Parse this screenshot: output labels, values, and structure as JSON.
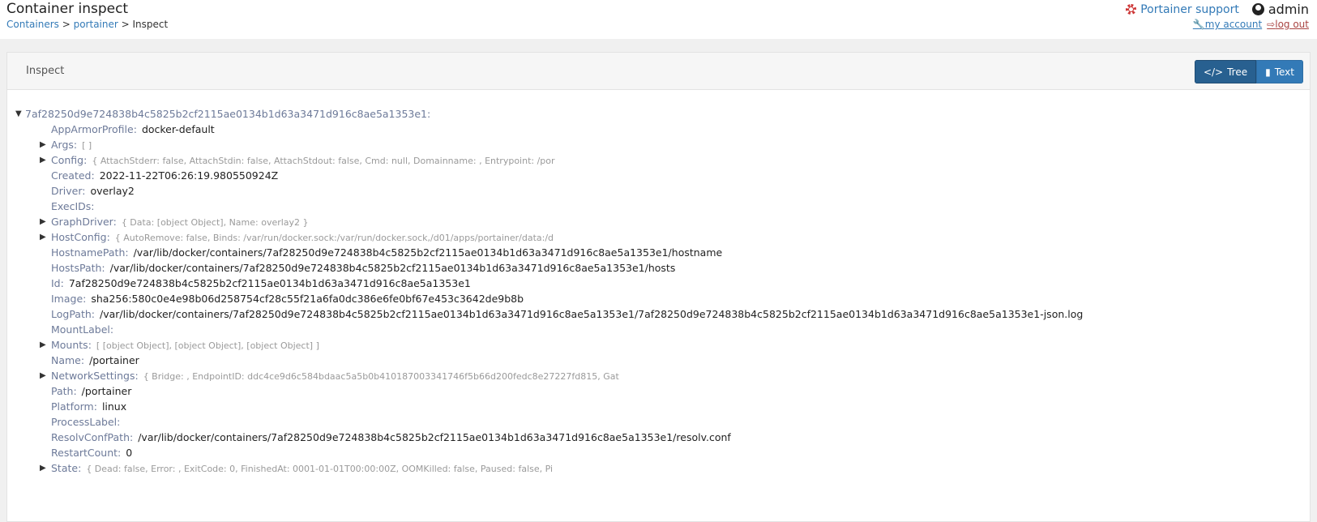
{
  "header": {
    "title": "Container inspect",
    "breadcrumb": [
      "Containers",
      "portainer",
      "Inspect"
    ],
    "support": "Portainer support",
    "user": "admin",
    "my_account": "my account",
    "log_out": "log out"
  },
  "panel": {
    "title": "Inspect",
    "tree_label": "Tree",
    "text_label": "Text"
  },
  "tree": {
    "root": "7af28250d9e724838b4c5825b2cf2115ae0134b1d63a3471d916c8ae5a1353e1:",
    "rows": [
      {
        "key": "AppArmorProfile:",
        "value": "docker-default",
        "expandable": false
      },
      {
        "key": "Args:",
        "preview": "[ ]",
        "expandable": true
      },
      {
        "key": "Config:",
        "preview": "{ AttachStderr: false, AttachStdin: false, AttachStdout: false, Cmd: null, Domainname: , Entrypoint: /por",
        "expandable": true
      },
      {
        "key": "Created:",
        "value": "2022-11-22T06:26:19.980550924Z",
        "expandable": false
      },
      {
        "key": "Driver:",
        "value": "overlay2",
        "expandable": false
      },
      {
        "key": "ExecIDs:",
        "value": "",
        "expandable": false
      },
      {
        "key": "GraphDriver:",
        "preview": "{ Data: [object Object], Name: overlay2 }",
        "expandable": true
      },
      {
        "key": "HostConfig:",
        "preview": "{ AutoRemove: false, Binds: /var/run/docker.sock:/var/run/docker.sock,/d01/apps/portainer/data:/d",
        "expandable": true
      },
      {
        "key": "HostnamePath:",
        "value": "/var/lib/docker/containers/7af28250d9e724838b4c5825b2cf2115ae0134b1d63a3471d916c8ae5a1353e1/hostname",
        "expandable": false
      },
      {
        "key": "HostsPath:",
        "value": "/var/lib/docker/containers/7af28250d9e724838b4c5825b2cf2115ae0134b1d63a3471d916c8ae5a1353e1/hosts",
        "expandable": false
      },
      {
        "key": "Id:",
        "value": "7af28250d9e724838b4c5825b2cf2115ae0134b1d63a3471d916c8ae5a1353e1",
        "expandable": false
      },
      {
        "key": "Image:",
        "value": "sha256:580c0e4e98b06d258754cf28c55f21a6fa0dc386e6fe0bf67e453c3642de9b8b",
        "expandable": false
      },
      {
        "key": "LogPath:",
        "value": "/var/lib/docker/containers/7af28250d9e724838b4c5825b2cf2115ae0134b1d63a3471d916c8ae5a1353e1/7af28250d9e724838b4c5825b2cf2115ae0134b1d63a3471d916c8ae5a1353e1-json.log",
        "expandable": false
      },
      {
        "key": "MountLabel:",
        "value": "",
        "expandable": false
      },
      {
        "key": "Mounts:",
        "preview": "[ [object Object], [object Object], [object Object] ]",
        "expandable": true
      },
      {
        "key": "Name:",
        "value": "/portainer",
        "expandable": false
      },
      {
        "key": "NetworkSettings:",
        "preview": "{ Bridge: , EndpointID: ddc4ce9d6c584bdaac5a5b0b410187003341746f5b66d200fedc8e27227fd815, Gat",
        "expandable": true
      },
      {
        "key": "Path:",
        "value": "/portainer",
        "expandable": false
      },
      {
        "key": "Platform:",
        "value": "linux",
        "expandable": false
      },
      {
        "key": "ProcessLabel:",
        "value": "",
        "expandable": false
      },
      {
        "key": "ResolvConfPath:",
        "value": "/var/lib/docker/containers/7af28250d9e724838b4c5825b2cf2115ae0134b1d63a3471d916c8ae5a1353e1/resolv.conf",
        "expandable": false
      },
      {
        "key": "RestartCount:",
        "value": "0",
        "expandable": false
      },
      {
        "key": "State:",
        "preview": "{ Dead: false, Error: , ExitCode: 0, FinishedAt: 0001-01-01T00:00:00Z, OOMKilled: false, Paused: false, Pi",
        "expandable": true
      }
    ]
  }
}
